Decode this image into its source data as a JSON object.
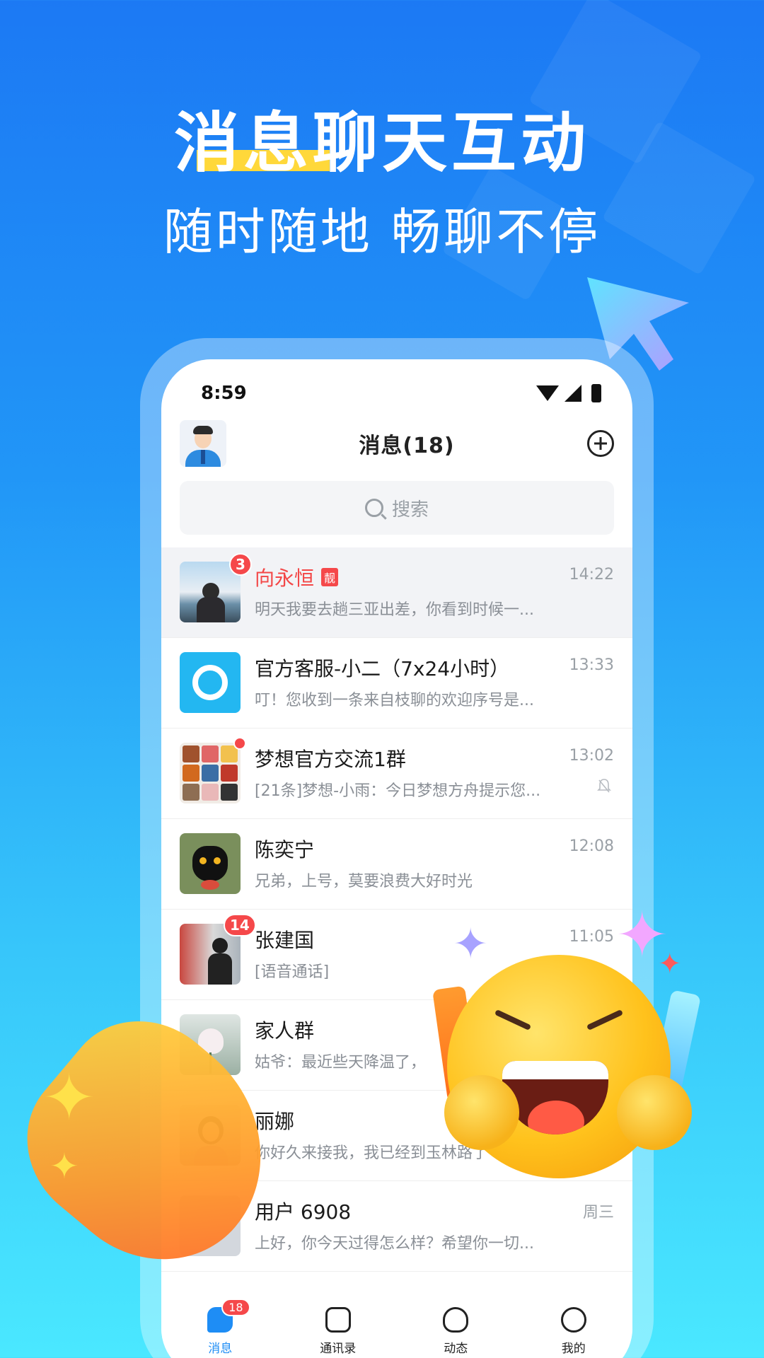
{
  "promo": {
    "headline": "消息聊天互动",
    "subhead": "随时随地 畅聊不停"
  },
  "status_bar": {
    "time": "8:59"
  },
  "header": {
    "title": "消息(18)"
  },
  "search": {
    "placeholder": "搜索"
  },
  "conversations": [
    {
      "name": "向永恒",
      "tag": "靓",
      "preview": "明天我要去趟三亚出差，你看到时候一...",
      "time": "14:22",
      "badge": "3"
    },
    {
      "name": "官方客服-小二（7x24小时）",
      "preview": "叮！您收到一条来自枝聊的欢迎序号是...",
      "time": "13:33"
    },
    {
      "name": "梦想官方交流1群",
      "preview": "[21条]梦想-小雨：今日梦想方舟提示您...",
      "time": "13:02",
      "muted": true,
      "dot": true
    },
    {
      "name": "陈奕宁",
      "preview": "兄弟，上号，莫要浪费大好时光",
      "time": "12:08"
    },
    {
      "name": "张建国",
      "preview": "[语音通话]",
      "time": "11:05",
      "badge": "14"
    },
    {
      "name": "家人群",
      "preview": "姑爷：最近些天降温了，"
    },
    {
      "name": "丽娜",
      "preview": "你好久来接我，我已经到玉林路了"
    },
    {
      "name": "用户 6908",
      "preview": "上好，你今天过得怎么样？希望你一切...",
      "time": "周三"
    }
  ],
  "tabbar": {
    "tabs": [
      {
        "label": "消息",
        "badge": "18",
        "active": true
      },
      {
        "label": "通讯录"
      },
      {
        "label": "动态"
      },
      {
        "label": "我的"
      }
    ]
  },
  "colors": {
    "accent": "#1e8df5",
    "badge": "#f5484a",
    "highlight_name": "#f34747"
  }
}
